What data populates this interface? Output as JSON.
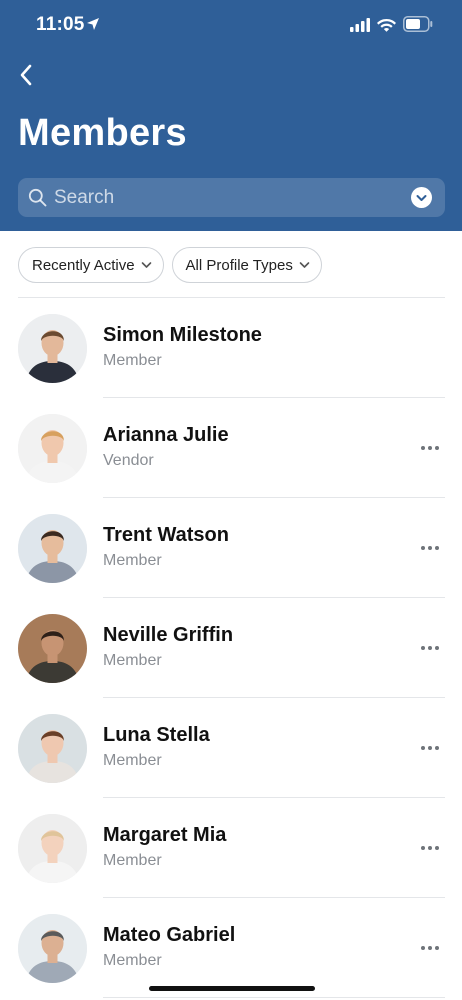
{
  "status_bar": {
    "time": "11:05"
  },
  "header": {
    "title": "Members"
  },
  "search": {
    "placeholder": "Search"
  },
  "filters": {
    "sort_label": "Recently Active",
    "profile_type_label": "All Profile Types"
  },
  "members": [
    {
      "name": "Simon Milestone",
      "type": "Member",
      "has_more": false,
      "skin": "#e3b89a",
      "hair": "#6b4a30",
      "shirt": "#2a2f3b",
      "bg": "#eceef0"
    },
    {
      "name": "Arianna Julie",
      "type": "Vendor",
      "has_more": true,
      "skin": "#f0c8ad",
      "hair": "#d7a05e",
      "shirt": "#f4f4f4",
      "bg": "#f2f2f2"
    },
    {
      "name": "Trent Watson",
      "type": "Member",
      "has_more": true,
      "skin": "#e6bc9c",
      "hair": "#3b2a20",
      "shirt": "#8c96a6",
      "bg": "#dfe6ec"
    },
    {
      "name": "Neville Griffin",
      "type": "Member",
      "has_more": true,
      "skin": "#c79473",
      "hair": "#2e2018",
      "shirt": "#3c3a34",
      "bg": "#a77b59"
    },
    {
      "name": "Luna Stella",
      "type": "Member",
      "has_more": true,
      "skin": "#efc8b0",
      "hair": "#6a3f27",
      "shirt": "#e7e3df",
      "bg": "#d9e0e3"
    },
    {
      "name": "Margaret Mia",
      "type": "Member",
      "has_more": true,
      "skin": "#f3d2bd",
      "hair": "#e0c49a",
      "shirt": "#f5f5f5",
      "bg": "#eeeeee"
    },
    {
      "name": "Mateo Gabriel",
      "type": "Member",
      "has_more": true,
      "skin": "#dcb092",
      "hair": "#5a5a5a",
      "shirt": "#9fa9b6",
      "bg": "#e7ecef"
    }
  ],
  "colors": {
    "header_bg": "#2f5f98",
    "secondary_text": "#8a8e94"
  }
}
